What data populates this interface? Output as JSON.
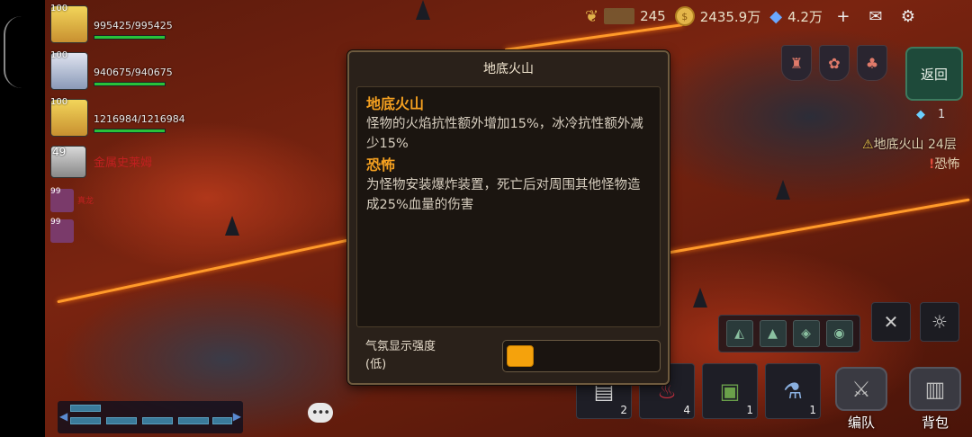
{
  "resources": {
    "wheat": {
      "value": "245",
      "icon": "wheat-icon"
    },
    "gold": {
      "value": "2435.9万",
      "icon": "gold-coin-icon",
      "coin_mark": "$"
    },
    "gems": {
      "value": "4.2万",
      "icon": "diamond-icon"
    },
    "add_icon": "+",
    "mail_icon": "✉",
    "settings_icon": "⚙"
  },
  "party": [
    {
      "level": "100",
      "name": "",
      "hp": "995425/995425",
      "hp_fraction": 1.0
    },
    {
      "level": "100",
      "name": "",
      "hp": "940675/940675",
      "hp_fraction": 1.0
    },
    {
      "level": "100",
      "name": "",
      "hp": "1216984/1216984",
      "hp_fraction": 1.0
    }
  ],
  "enemy": {
    "level": "49",
    "name": "金属史莱姆"
  },
  "minis": [
    {
      "level": "99",
      "name": "真龙"
    },
    {
      "level": "99",
      "name": ""
    }
  ],
  "right_panel": {
    "back_label": "返回",
    "key_count": "1",
    "location_warn": "⚠",
    "location": "地底火山 24层",
    "affix_mark": "!",
    "affix": "恐怖"
  },
  "modal": {
    "title": "地底火山",
    "sections": [
      {
        "title": "地底火山",
        "desc": "怪物的火焰抗性额外增加15%，冰冷抗性额外减少15%"
      },
      {
        "title": "恐怖",
        "desc": "为怪物安装爆炸装置，死亡后对周围其他怪物造成25%血量的伤害"
      }
    ],
    "intensity_label": "气氛显示强度",
    "intensity_value": "(低)",
    "intensity_level": "low"
  },
  "items": [
    {
      "icon": "scroll-icon",
      "count": "2"
    },
    {
      "icon": "potion-icon",
      "count": "4"
    },
    {
      "icon": "chest-icon",
      "count": "1"
    },
    {
      "icon": "bottle-icon",
      "count": "1"
    }
  ],
  "buttons": {
    "team_label": "编队",
    "bag_label": "背包"
  },
  "chat_icon": "•••"
}
